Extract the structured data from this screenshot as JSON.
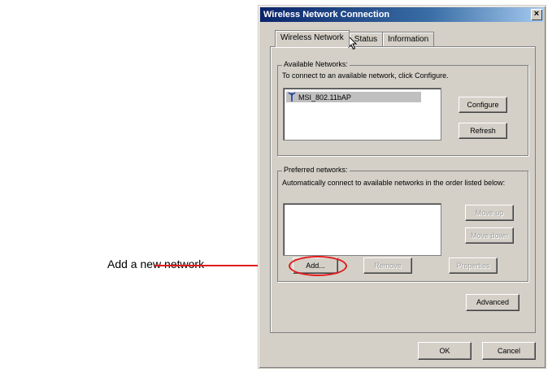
{
  "window": {
    "title": "Wireless Network Connection",
    "close_glyph": "×"
  },
  "tabs": [
    {
      "label": "Wireless Network",
      "active": true
    },
    {
      "label": "Status",
      "active": false
    },
    {
      "label": "Information",
      "active": false
    }
  ],
  "available": {
    "legend": "Available Networks:",
    "description": "To connect to an available network, click Configure.",
    "networks": [
      {
        "name": "MSI_802.11bAP",
        "icon": "antenna-icon"
      }
    ],
    "configure_label": "Configure",
    "refresh_label": "Refresh"
  },
  "preferred": {
    "legend": "Preferred networks:",
    "description": "Automatically connect to available networks in the order listed below:",
    "move_up_label": "Move up",
    "move_down_label": "Move down",
    "add_label": "Add...",
    "remove_label": "Remove",
    "properties_label": "Properties"
  },
  "advanced_label": "Advanced",
  "ok_label": "OK",
  "cancel_label": "Cancel",
  "callout": {
    "label": "Add a new network",
    "color": "#e21b1b"
  }
}
